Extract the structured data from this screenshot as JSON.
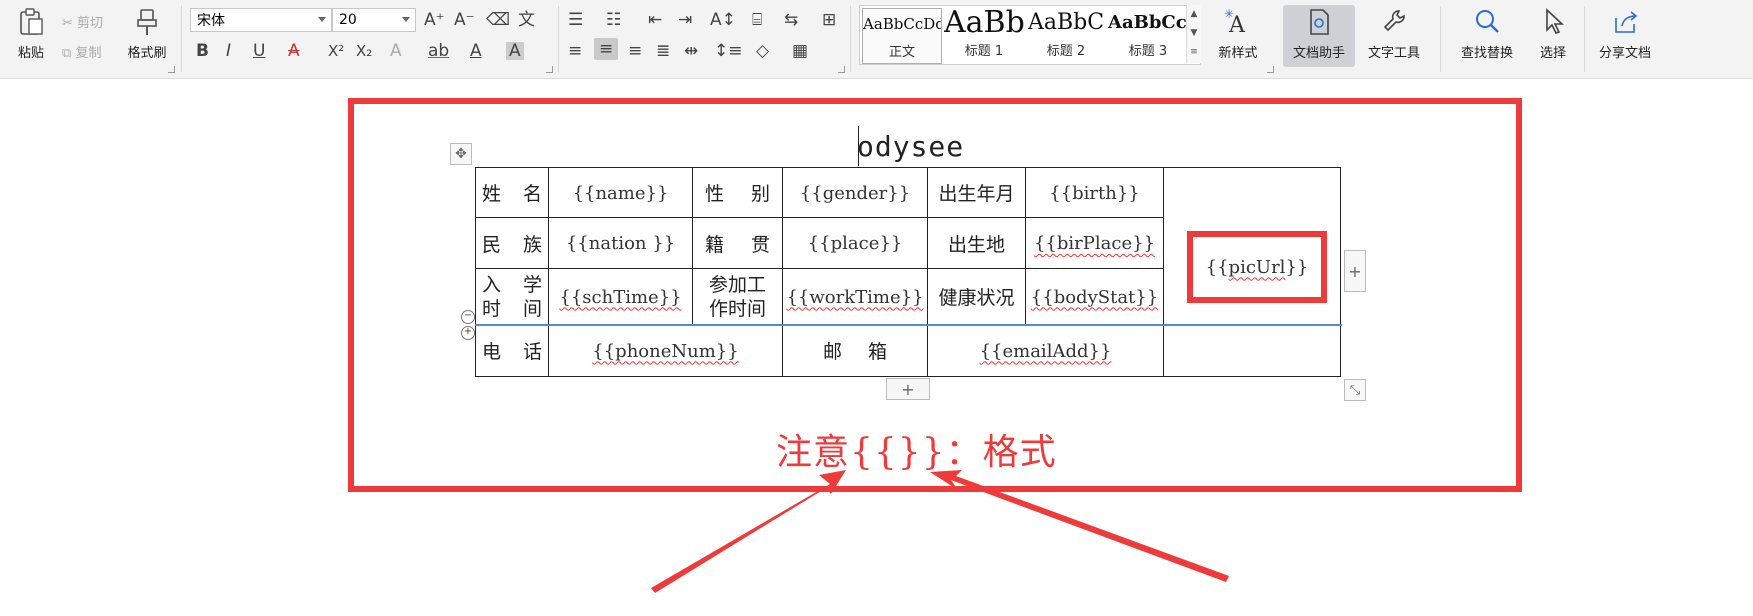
{
  "ribbon": {
    "clipboard": {
      "paste": "粘贴",
      "cut": "剪切",
      "copy": "复制",
      "format_painter": "格式刷"
    },
    "font": {
      "family": "宋体",
      "size": "20"
    },
    "font_buttons": [
      "B",
      "I",
      "U",
      "A",
      "X²",
      "X₂",
      "A",
      "ab",
      "A",
      "A"
    ],
    "styles": [
      {
        "sample": "AaBbCcDd",
        "name": "正文"
      },
      {
        "sample": "AaBb",
        "name": "标题 1"
      },
      {
        "sample": "AaBbC",
        "name": "标题 2"
      },
      {
        "sample": "AaBbCcI",
        "name": "标题 3"
      }
    ],
    "new_style": "新样式",
    "doc_assistant": "文档助手",
    "text_tools": "文字工具",
    "find_replace": "查找替换",
    "select": "选择",
    "share": "分享文档"
  },
  "document": {
    "title": "odysee",
    "table": {
      "row1": {
        "l1": [
          "姓",
          "名"
        ],
        "v1": "{{name}}",
        "l2": [
          "性",
          "别"
        ],
        "v2": "{{gender}}",
        "l3": "出生年月",
        "v3": "{{birth}}"
      },
      "row2": {
        "l1": [
          "民",
          "族"
        ],
        "v1": "{{nation }}",
        "l2": [
          "籍",
          "贯"
        ],
        "v2": "{{place}}",
        "l3": "出生地",
        "v3": "{{birPlace}}"
      },
      "row3": {
        "l1a": [
          "入",
          "学"
        ],
        "l1b": [
          "时",
          "间"
        ],
        "v1": "{{schTime}}",
        "l2a": "参加工",
        "l2b": "作时间",
        "v2": "{{workTime}}",
        "l3": "健康状况",
        "v3": "{{bodyStat}}"
      },
      "row4": {
        "l1": [
          "电",
          "话"
        ],
        "v1": "{{phoneNum}}",
        "l2": [
          "邮",
          "箱"
        ],
        "v2": "{{emailAdd}}"
      },
      "pic": "{{picUrl}}"
    },
    "note": "注意{{}}：格式"
  },
  "colors": {
    "annotation_red": "#ee3a3a",
    "ribbon_bg": "#f3f3f3"
  }
}
